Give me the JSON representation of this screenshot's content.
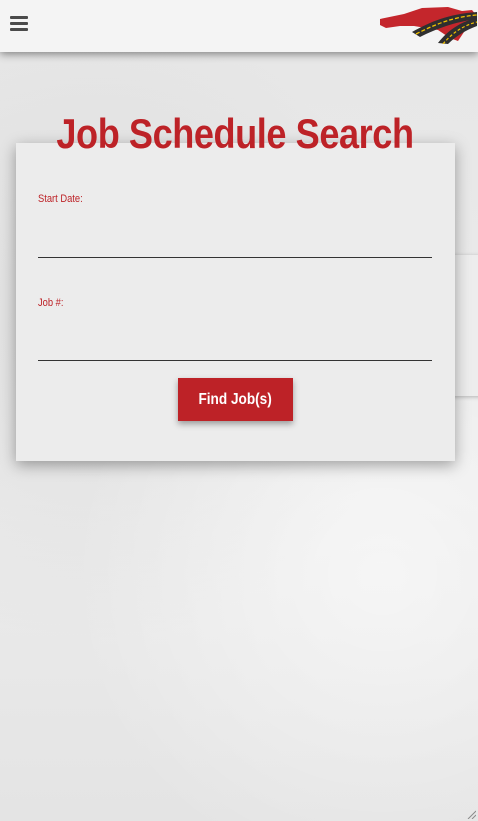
{
  "header": {
    "menu_icon": "hamburger-menu-icon",
    "logo_icon": "north-carolina-road-logo"
  },
  "page": {
    "title": "Job Schedule Search"
  },
  "form": {
    "start_date_label": "Start Date:",
    "start_date_value": "",
    "job_number_label": "Job #:",
    "job_number_value": "",
    "submit_label": "Find Job(s)"
  },
  "colors": {
    "brand_red": "#bd2227",
    "background": "#e9e9e9",
    "header_bg": "#f4f4f4",
    "logo_road": "#2f2f2f",
    "logo_lane": "#f2c200"
  }
}
